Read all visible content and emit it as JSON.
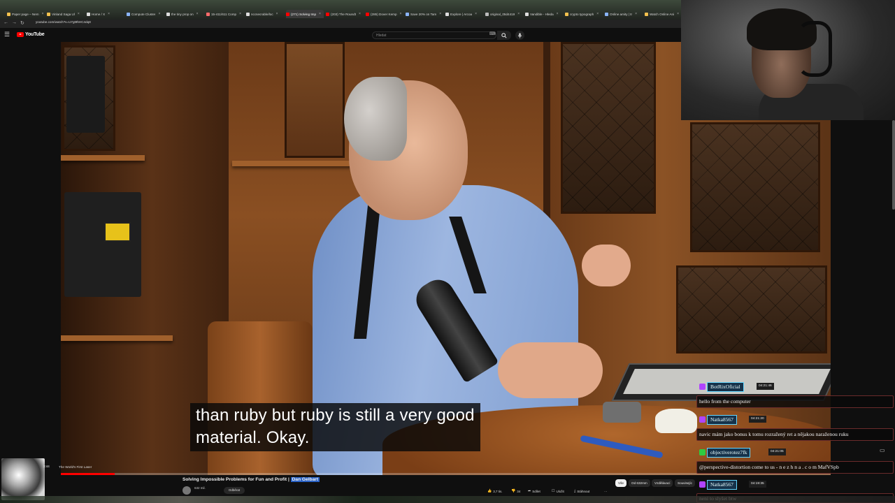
{
  "browser": {
    "tabs": [
      {
        "label": "Paper page – Nem",
        "favicon_color": "#f2c14e"
      },
      {
        "label": "Vinland Saga Ul",
        "favicon_color": "#f2c14e"
      },
      {
        "label": "Home / X",
        "favicon_color": "#dddddd"
      },
      {
        "label": "Compute Cluster",
        "favicon_color": "#8ab4f8"
      },
      {
        "label": "the tiny prop on",
        "favicon_color": "#dddddd"
      },
      {
        "label": "15-411/611 Comp",
        "favicon_color": "#ff6b6b"
      },
      {
        "label": "nccsecrable/loc",
        "favicon_color": "#dddddd"
      },
      {
        "label": "(271) Solving Imp",
        "favicon_color": "#ff0000",
        "active": true
      },
      {
        "label": "(203) The Roundt",
        "favicon_color": "#ff0000"
      },
      {
        "label": "(285) Dover Kemp",
        "favicon_color": "#ff0000"
      },
      {
        "label": "Save 20% on Tam",
        "favicon_color": "#8ab4f8"
      },
      {
        "label": "Explore | Arcoa",
        "favicon_color": "#dddddd"
      },
      {
        "label": "original_05d4419",
        "favicon_color": "#bbbbbb"
      },
      {
        "label": "Vandible - Hleda",
        "favicon_color": "#dddddd"
      },
      {
        "label": "crypto typograph",
        "favicon_color": "#f2c14e"
      },
      {
        "label": "Online amity | tr",
        "favicon_color": "#8ab4f8"
      },
      {
        "label": "Watch Online Ani",
        "favicon_color": "#f2c14e"
      }
    ],
    "url": "youtube.com/watch?v=U7gt9hHC4dq8"
  },
  "youtube": {
    "logo_text": "YouTube",
    "search_placeholder": "Hledat",
    "subtitle_lines": [
      "than ruby but ruby is still a very good",
      "material. Okay."
    ],
    "progress_fraction": 0.07,
    "player_time": "3:44",
    "chapter": "The World's First Laser",
    "video_title": "Solving Impossible Problems for Fun and Profit |",
    "video_title_highlight": "Dan Gelbart",
    "channel_subs": "632 mil.",
    "subscribe_label": "Odběrat",
    "actions": [
      {
        "icon": "thumb-up-icon",
        "label": "3,7 tis."
      },
      {
        "icon": "thumb-down-icon",
        "label": "34"
      },
      {
        "icon": "share-icon",
        "label": "Sdílet"
      },
      {
        "icon": "save-icon",
        "label": "Uložit"
      },
      {
        "icon": "download-icon",
        "label": "Stáhnout"
      },
      {
        "icon": "more-icon",
        "label": "···"
      }
    ],
    "filter_pills": [
      {
        "label": "Vše",
        "selected": true
      },
      {
        "label": "Od 632mm",
        "selected": false
      },
      {
        "label": "Vzdělávací",
        "selected": false
      },
      {
        "label": "Souvisejíc",
        "selected": false
      }
    ]
  },
  "chat": [
    {
      "user": "BotRixOficial",
      "time": "04:21:46",
      "message": "hello from the computer",
      "badge_color": "#b044ff"
    },
    {
      "user": "Natka8567",
      "time": "04:21:20",
      "message": "navic mám jako bonus k tomu rozražený ret a nějakou naraženou ruku",
      "badge_color": "#b044ff"
    },
    {
      "user": "objectiverotez7fk",
      "time": "04:21:05",
      "message": "@perspective-distortion come to us - n e z h n a . c o m MafVSpb",
      "badge_color": "#2ecc40"
    },
    {
      "user": "Natka8567",
      "time": "04:19:35",
      "message": "neni to slyšet btw",
      "badge_color": "#b044ff"
    }
  ]
}
